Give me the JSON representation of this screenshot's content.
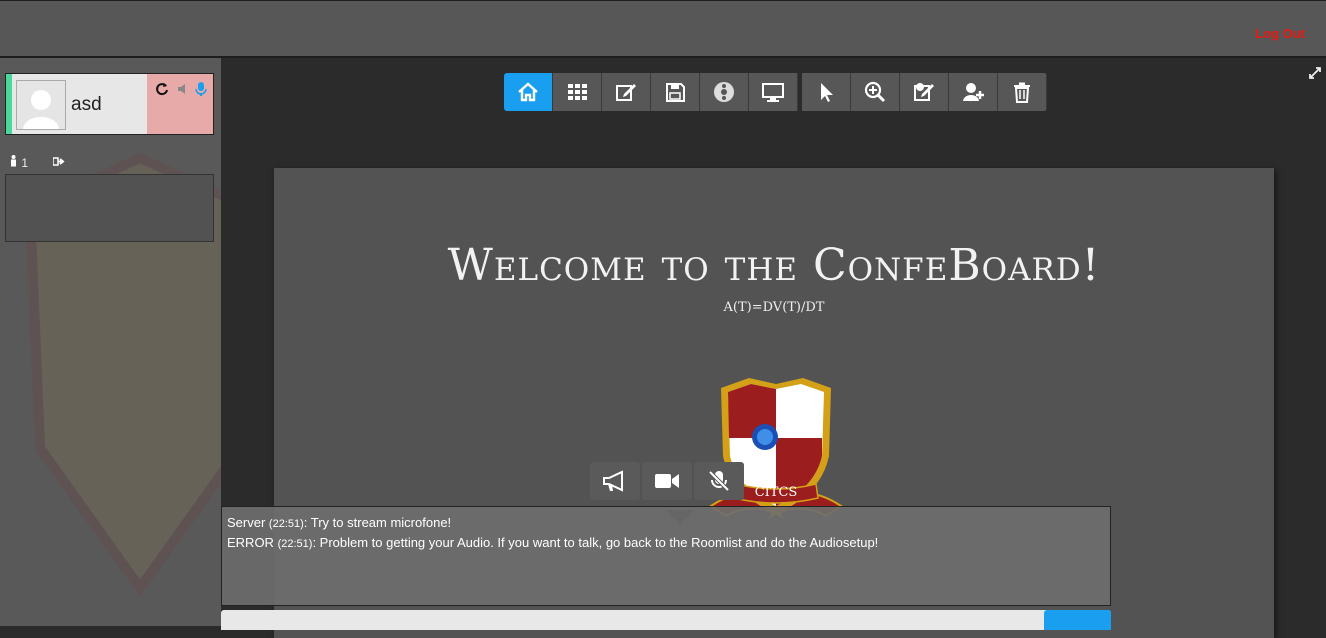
{
  "header": {
    "logout_label": "Log Out"
  },
  "sidebar": {
    "user": {
      "name": "asd",
      "icons": [
        "refresh-icon",
        "speaker-icon",
        "microphone-icon"
      ]
    },
    "participants_count": "1"
  },
  "toolbar": {
    "buttons": [
      "home-icon",
      "grid-icon",
      "edit-icon",
      "save-icon",
      "disc-icon",
      "monitor-icon",
      "pointer-icon",
      "zoom-icon",
      "annotate-icon",
      "add-user-icon",
      "trash-icon"
    ],
    "active": "home-icon"
  },
  "board": {
    "title": "Welcome to the ConfeBoard!",
    "formula": "A(T)=DV(T)/DT",
    "crest_text": "CITCS"
  },
  "media": {
    "buttons": [
      "megaphone-icon",
      "video-camera-icon",
      "mute-icon"
    ]
  },
  "chat": {
    "messages": [
      {
        "sender": "Server",
        "time": "(22:51)",
        "text": ": Try to stream microfone!"
      },
      {
        "sender": "ERROR",
        "time": "(22:51)",
        "text": ": Problem to getting your Audio. If you want to talk, go back to the Roomlist and do the Audiosetup!"
      }
    ]
  },
  "colors": {
    "accent": "#1a9ff0",
    "logout": "#e8190f",
    "speaking": "#4ad89a"
  }
}
